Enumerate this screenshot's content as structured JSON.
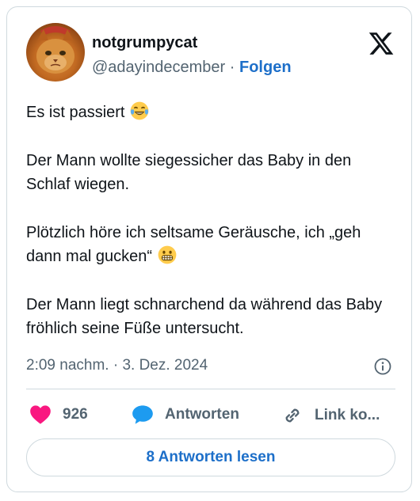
{
  "author": {
    "display_name": "notgrumpycat",
    "handle": "@adayindecember",
    "separator": "·",
    "follow_label": "Folgen"
  },
  "tweet": {
    "paragraphs": [
      {
        "text": "Es ist passiert",
        "emoji": "face-with-tears-of-joy"
      },
      {
        "text": "Der Mann wollte siegessicher das Baby in den Schlaf wiegen."
      },
      {
        "text": "Plötzlich höre ich seltsame Geräusche, ich „geh dann mal gucken“",
        "emoji": "grimacing-face"
      },
      {
        "text": "Der Mann liegt schnarchend da während das Baby fröhlich seine Füße untersucht."
      }
    ],
    "timestamp": "2:09 nachm. · 3. Dez. 2024"
  },
  "actions": {
    "like_count": "926",
    "reply_label": "Antworten",
    "link_label": "Link ko..."
  },
  "read_replies_label": "8 Antworten lesen",
  "icons": {
    "brand": "x-logo-icon",
    "info": "info-icon",
    "like": "heart-icon",
    "reply": "speech-bubble-icon",
    "link": "chain-link-icon"
  },
  "colors": {
    "text": "#0f1419",
    "secondary": "#536471",
    "link_blue": "#1d6fc9",
    "heart": "#f91880",
    "reply_blue": "#1d9bf0",
    "border": "#cfd9de"
  }
}
